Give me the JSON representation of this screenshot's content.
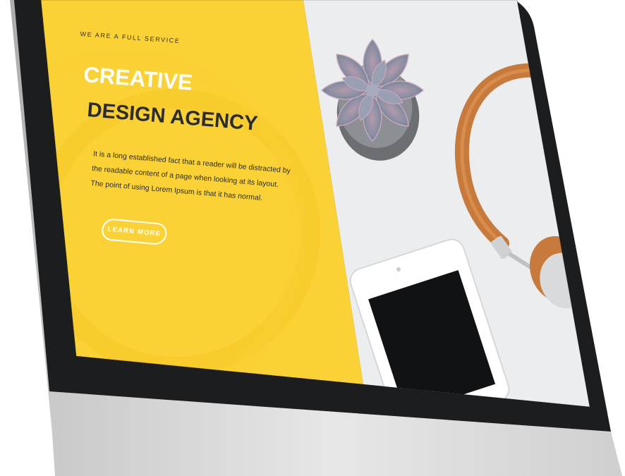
{
  "hero": {
    "tagline": "WE ARE A FULL SERVICE",
    "title_line1": "CREATIVE",
    "title_line2": "DESIGN AGENCY",
    "body": "It is a long established fact that a reader will be distracted by the readable content of a page when looking at its layout. The point of using Lorem Ipsum is that it has normal.",
    "button_label": "LEARN MORE"
  },
  "colors": {
    "accent_yellow": "#fbd236",
    "bezel_dark": "#1c1d1f",
    "chin_silver": "#dcdcdc",
    "text_dark": "#2b2c30",
    "photo_background": "#eef0f0",
    "headphone_leather": "#c8793c"
  },
  "icons": {
    "succulent": "succulent-plant",
    "headphones": "headphones",
    "phone": "smartphone"
  }
}
